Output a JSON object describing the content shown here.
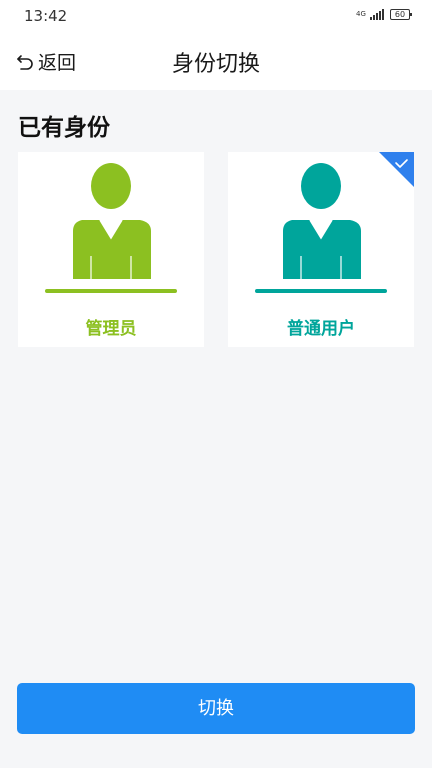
{
  "status_bar": {
    "time": "13:42",
    "network": "4G",
    "battery": "60"
  },
  "nav": {
    "back_label": "返回",
    "title": "身份切换"
  },
  "section": {
    "title": "已有身份"
  },
  "identities": [
    {
      "label": "管理员",
      "color": "#8cc021",
      "selected": false
    },
    {
      "label": "普通用户",
      "color": "#00a59b",
      "selected": true
    }
  ],
  "selected_badge_color": "#2f80ed",
  "switch_button": {
    "label": "切换",
    "color": "#1f8cf4"
  }
}
